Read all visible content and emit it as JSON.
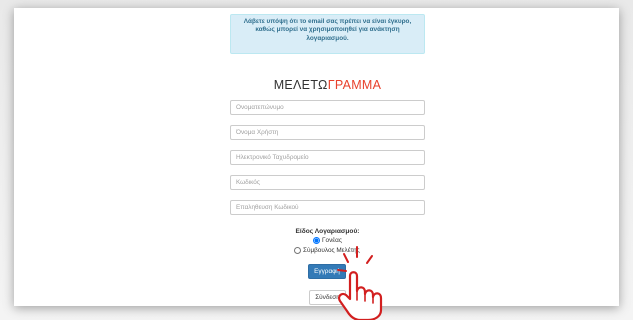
{
  "notice": {
    "line1": "Λάβετε υπόψη ότι το email σας πρέπει να είναι έγκυρο,",
    "line2": "καθώς μπορεί να χρησιμοποιηθεί για ανάκτηση",
    "line3": "λογαριασμού."
  },
  "brand": {
    "part1": "ΜΕΛΕΤΩ",
    "part2": "ΓΡΑΜΜΑ"
  },
  "form": {
    "fullname_placeholder": "Ονοματεπώνυμο",
    "username_placeholder": "Όνομα Χρήστη",
    "email_placeholder": "Ηλεκτρονικό Ταχυδρομείο",
    "password_placeholder": "Κωδικός",
    "confirm_password_placeholder": "Επαληθευση Κωδικού",
    "account_type_label": "Είδος Λογαριασμού:",
    "account_types": [
      {
        "label": "Γονέας",
        "selected": true
      },
      {
        "label": "Σύμβουλος Μελέτης",
        "selected": false
      }
    ],
    "register_label": "Εγγραφή",
    "login_label": "Σύνδεση"
  },
  "colors": {
    "brand_dark": "#333333",
    "brand_accent": "#e8412c",
    "notice_bg": "#d9edf7",
    "notice_text": "#31708f",
    "primary_button": "#337ab7",
    "cursor_red": "#d21f1f"
  },
  "icons": {
    "pointer": "hand-pointer-icon"
  }
}
